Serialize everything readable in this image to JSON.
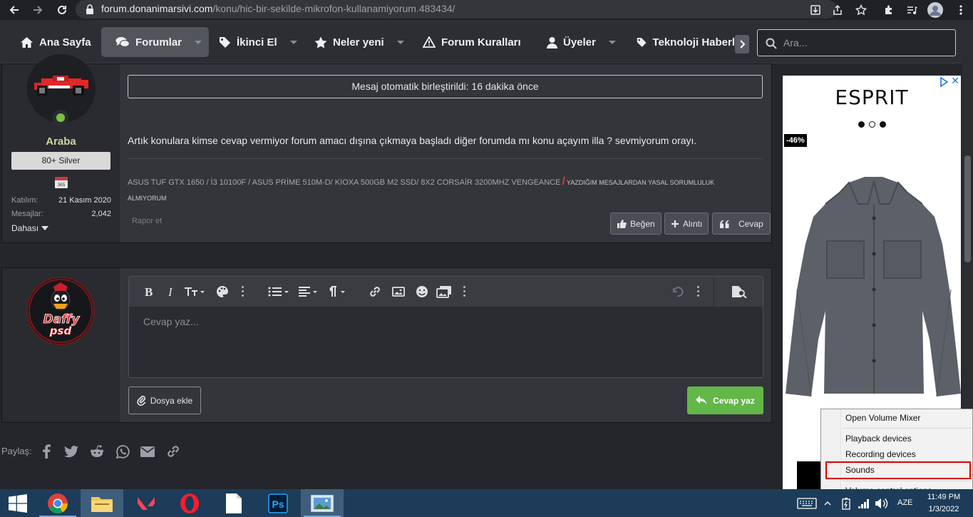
{
  "browser": {
    "url_host": "forum.donanimarsivi.com",
    "url_path": "/konu/hic-bir-sekilde-mikrofon-kullanamiyorum.483434/"
  },
  "nav": {
    "home": "Ana Sayfa",
    "forums": "Forumlar",
    "second_hand": "İkinci El",
    "whats_new": "Neler yeni",
    "rules": "Forum Kuralları",
    "members": "Üyeler",
    "tech_news": "Teknoloji Haberl",
    "search_placeholder": "Ara..."
  },
  "post": {
    "username": "Araba",
    "rank": "80+ Silver",
    "calendar_day": "365",
    "stats": [
      {
        "key": "Katılım:",
        "value": "21 Kasım 2020"
      },
      {
        "key": "Mesajlar:",
        "value": "2,042"
      }
    ],
    "more": "Dahası",
    "merge_notice": "Mesaj otomatik birleştirildi: 16 dakika önce",
    "body": "Artık konulara kimse cevap vermiyor forum amacı dışına çıkmaya başladı diğer forumda mı konu açayım illa ? sevmiyorum orayı.",
    "signature": "ASUS TUF GTX 1650 / İ3 10100F / ASUS PRİME 510M-D/ KIOXA 500GB M2 SSD/ 8X2 CORSAİR 3200MHZ VENGEANCE",
    "signature_slash": "/",
    "signature_disclaimer": "YAZDIĞIM MESAJLARDAN YASAL SORUMLULUK ALMIYORUM",
    "report": "Rapor et",
    "like": "Beğen",
    "quote": "Alıntı",
    "reply": "Cevap"
  },
  "reply_box": {
    "placeholder": "Cevap yaz...",
    "attach": "Dosya ekle",
    "submit": "Cevap yaz"
  },
  "share": {
    "label": "Paylaş:",
    "icons": [
      "facebook-icon",
      "twitter-icon",
      "reddit-icon",
      "whatsapp-icon",
      "email-icon",
      "link-icon"
    ]
  },
  "ad": {
    "brand": "ESPRIT",
    "discount": "-46%",
    "close": "✕"
  },
  "context_menu": {
    "items": [
      "Open Volume Mixer",
      "Playback devices",
      "Recording devices",
      "Sounds",
      "Volume control options"
    ],
    "highlighted": "Sounds"
  },
  "taskbar": {
    "apps": [
      "chrome-icon",
      "file-explorer-icon",
      "valorant-icon",
      "opera-icon",
      "blank-document-icon",
      "photoshop-icon",
      "photos-icon"
    ],
    "language": "AZE",
    "time": "11:49 PM",
    "date": "1/3/2022"
  },
  "colors": {
    "page_bg": "#24262b",
    "card_bg": "#33353b",
    "accent_green": "#63b648",
    "taskbar": "#1c3c5a",
    "highlight_red": "#e00000"
  }
}
